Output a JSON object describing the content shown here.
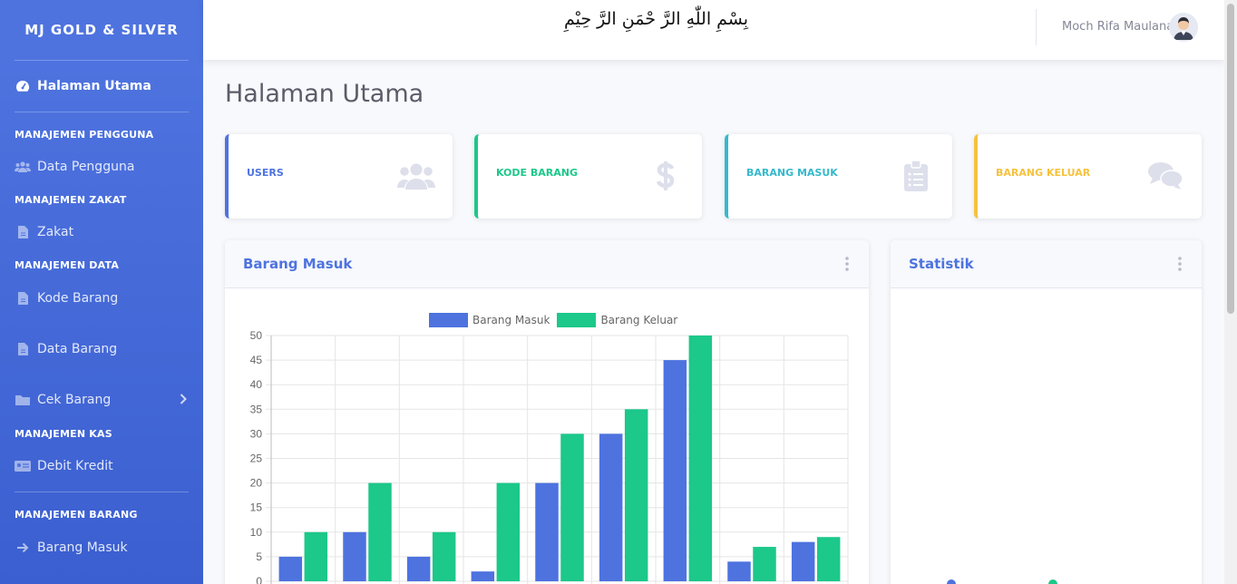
{
  "brand": "MJ GOLD & SILVER",
  "topbar": {
    "bismillah": "بِسْمِ اللّٰهِ الرَّ حْمَنِ الرَّ حِيْمِ",
    "username": "Moch Rifa Maulana"
  },
  "sidebar": {
    "dashboard": "Halaman Utama",
    "sections": [
      {
        "heading": "MANAJEMEN PENGGUNA",
        "items": [
          {
            "label": "Data Pengguna",
            "icon": "users-icon"
          }
        ]
      },
      {
        "heading": "MANAJEMEN ZAKAT",
        "items": [
          {
            "label": "Zakat",
            "icon": "file-icon"
          }
        ]
      },
      {
        "heading": "MANAJEMEN DATA",
        "items": [
          {
            "label": "Kode Barang",
            "icon": "file-icon"
          },
          {
            "label": "Data Barang",
            "icon": "file-icon"
          },
          {
            "label": "Cek Barang",
            "icon": "folder-icon"
          }
        ]
      },
      {
        "heading": "MANAJEMEN KAS",
        "items": [
          {
            "label": "Debit Kredit",
            "icon": "id-card-icon"
          }
        ]
      },
      {
        "heading": "MANAJEMEN BARANG",
        "items": [
          {
            "label": "Barang Masuk",
            "icon": "arrow-right-icon"
          }
        ]
      }
    ]
  },
  "page_title": "Halaman Utama",
  "cards": [
    {
      "label": "USERS",
      "color": "#4e73df",
      "icon": "users-icon"
    },
    {
      "label": "KODE BARANG",
      "color": "#1cc88a",
      "icon": "dollar-icon"
    },
    {
      "label": "BARANG MASUK",
      "color": "#36b9cc",
      "icon": "clipboard-icon"
    },
    {
      "label": "BARANG KELUAR",
      "color": "#f6c23e",
      "icon": "comments-icon"
    }
  ],
  "panels": {
    "chart_title": "Barang Masuk",
    "stats_title": "Statistik"
  },
  "chart_data": {
    "type": "bar",
    "categories": [
      "",
      "",
      "",
      "",
      "",
      "",
      "",
      "",
      ""
    ],
    "series": [
      {
        "name": "Barang Masuk",
        "color": "#4e73df",
        "values": [
          5,
          10,
          5,
          2,
          20,
          30,
          45,
          4,
          8
        ]
      },
      {
        "name": "Barang Keluar",
        "color": "#1cc88a",
        "values": [
          10,
          20,
          10,
          20,
          30,
          35,
          50,
          7,
          9
        ]
      }
    ],
    "yticks": [
      "0",
      "5",
      "10",
      "15",
      "20",
      "25",
      "30",
      "35",
      "40",
      "45",
      "50"
    ],
    "ylim": [
      0,
      50
    ],
    "grid": true,
    "legend": "top"
  }
}
